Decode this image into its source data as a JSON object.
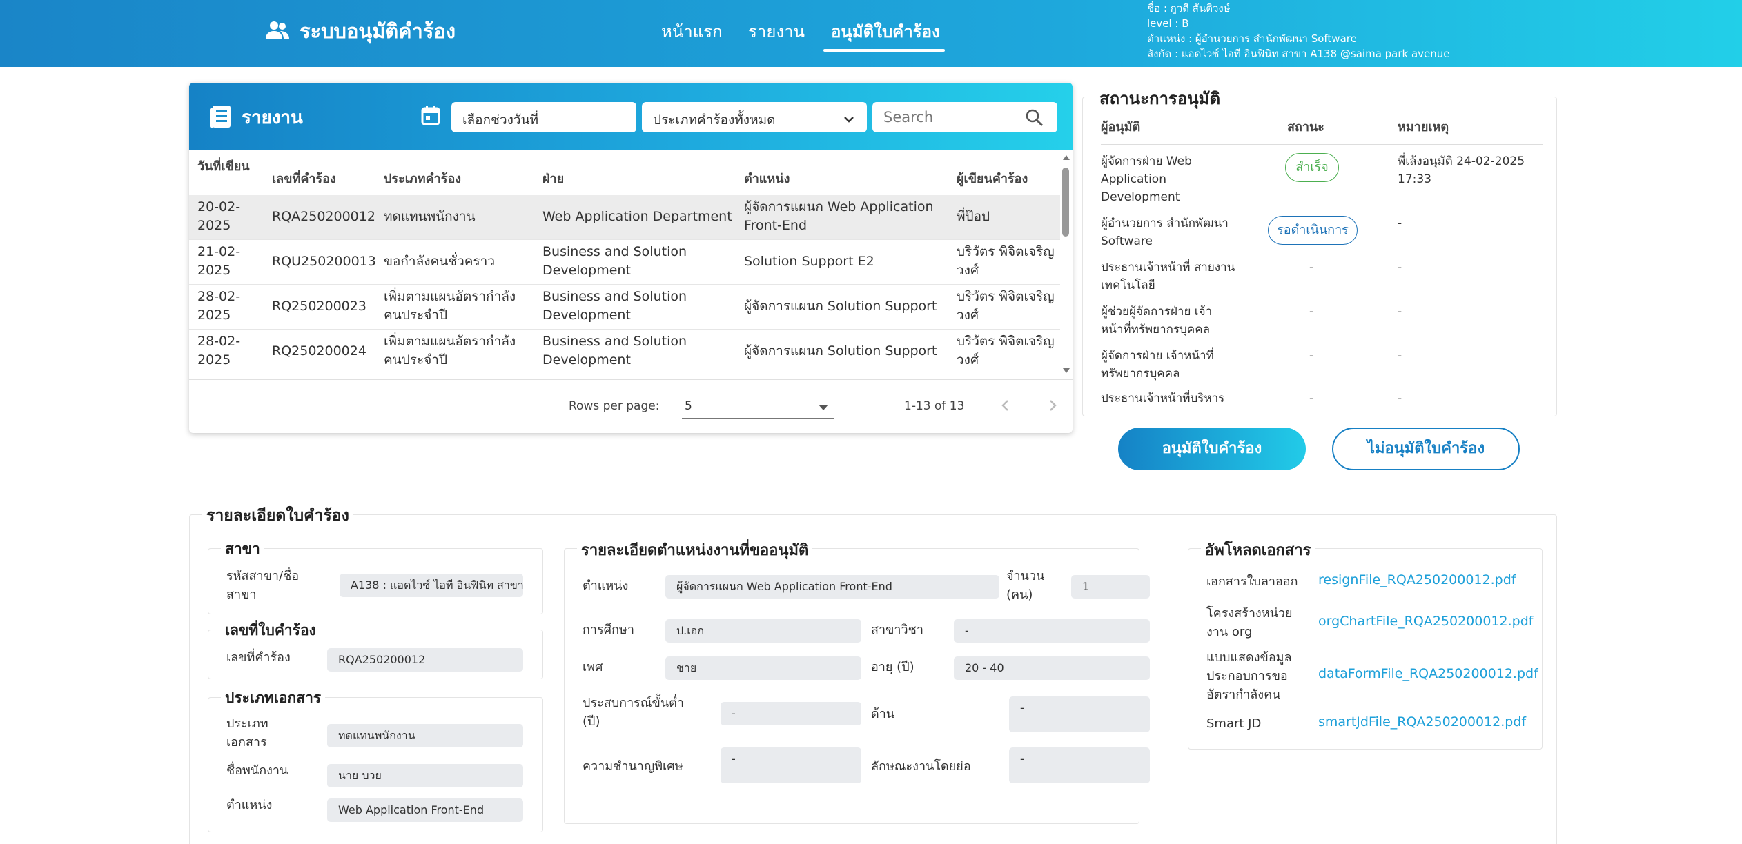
{
  "header": {
    "app_title": "ระบบอนุมัติคำร้อง",
    "nav": [
      {
        "label": "หน้าแรก"
      },
      {
        "label": "รายงาน"
      },
      {
        "label": "อนุมัติใบคำร้อง",
        "active": true
      }
    ],
    "user": {
      "name": "ชื่อ : กูวดี สันติวงษ์",
      "level": "level : B",
      "position": "ตำแหน่ง : ผู้อำนวยการ สำนักพัฒนา Software",
      "affiliation": "สังกัด : แอดไวซ์ ไอที อินฟินิท สาขา A138 @saima park avenue"
    }
  },
  "report": {
    "title": "รายงาน",
    "date_placeholder": "เลือกช่วงวันที่",
    "type_select": "ประเภทคำร้องทั้งหมด",
    "search_placeholder": "Search",
    "columns": [
      "วันที่เขียน",
      "เลขที่คำร้อง",
      "ประเภทคำร้อง",
      "ฝ่าย",
      "ตำแหน่ง",
      "ผู้เขียนคำร้อง"
    ],
    "rows": [
      {
        "date": "20-02-2025",
        "no": "RQA250200012",
        "type": "ทดแทนพนักงาน",
        "dept": "Web Application Department",
        "position": "ผู้จัดการแผนก Web Application Front-End",
        "writer": "พี่ป๊อป"
      },
      {
        "date": "21-02-2025",
        "no": "RQU250200013",
        "type": "ขอกำลังคนชั่วคราว",
        "dept": "Business and Solution Development",
        "position": "Solution Support E2",
        "writer": "บริวัตร พิจิตเจริญวงศ์"
      },
      {
        "date": "28-02-2025",
        "no": "RQ250200023",
        "type": "เพิ่มตามแผนอัตรากำลังคนประจำปี",
        "dept": "Business and Solution Development",
        "position": "ผู้จัดการแผนก Solution Support",
        "writer": "บริวัตร พิจิตเจริญวงศ์"
      },
      {
        "date": "28-02-2025",
        "no": "RQ250200024",
        "type": "เพิ่มตามแผนอัตรากำลังคนประจำปี",
        "dept": "Business and Solution Development",
        "position": "ผู้จัดการแผนก Solution Support",
        "writer": "บริวัตร พิจิตเจริญวงศ์"
      }
    ],
    "pagination": {
      "rows_per_page_label": "Rows per page:",
      "rows_per_page": "5",
      "range": "1-13 of 13"
    }
  },
  "approval": {
    "title": "สถานะการอนุมัติ",
    "columns": [
      "ผู้อนุมัติ",
      "สถานะ",
      "หมายเหตุ"
    ],
    "rows": [
      {
        "approver": "ผู้จัดการฝ่าย Web Application Development",
        "status": "สำเร็จ",
        "note": "พี่เล้งอนุมัติ 24-02-2025 17:33"
      },
      {
        "approver": "ผู้อำนวยการ สำนักพัฒนา Software",
        "status": "รอดำเนินการ",
        "note": "-"
      },
      {
        "approver": "ประธานเจ้าหน้าที่ สายงานเทคโนโลยี",
        "status": "-",
        "note": "-"
      },
      {
        "approver": "ผู้ช่วยผู้จัดการฝ่าย เจ้าหน้าที่ทรัพยากรบุคคล",
        "status": "-",
        "note": "-"
      },
      {
        "approver": "ผู้จัดการฝ่าย เจ้าหน้าที่ทรัพยากรบุคคล",
        "status": "-",
        "note": "-"
      },
      {
        "approver": "ประธานเจ้าหน้าที่บริหาร",
        "status": "-",
        "note": "-"
      }
    ],
    "approve_button": "อนุมัติใบคำร้อง",
    "reject_button": "ไม่อนุมัติใบคำร้อง"
  },
  "details": {
    "title": "รายละเอียดใบคำร้อง",
    "branch": {
      "title": "สาขา",
      "code_label": "รหัสสาขา/ชื่อสาขา",
      "code_value": "A138 : แอดไวซ์ ไอที อินฟินิท สาขา A"
    },
    "request": {
      "title": "เลขที่ใบคำร้อง",
      "no_label": "เลขที่คำร้อง",
      "no_value": "RQA250200012"
    },
    "doc_type": {
      "title": "ประเภทเอกสาร",
      "type_label": "ประเภทเอกสาร",
      "type_value": "ทดแทนพนักงาน",
      "emp_label": "ชื่อพนักงาน",
      "emp_value": "นาย บวย",
      "pos_label": "ตำแหน่ง",
      "pos_value": "Web Application Front-End"
    },
    "position": {
      "title": "รายละเอียดตำแหน่งงานที่ขออนุมัติ",
      "position_label": "ตำแหน่ง",
      "position_value": "ผู้จัดการแผนก Web Application Front-End",
      "count_label": "จำนวน (คน)",
      "count_value": "1",
      "education_label": "การศึกษา",
      "education_value": "ป.เอก",
      "major_label": "สาขาวิชา",
      "major_value": "-",
      "gender_label": "เพศ",
      "gender_value": "ชาย",
      "age_label": "อายุ (ปี)",
      "age_value": "20 - 40",
      "exp_label": "ประสบการณ์ขั้นต่ำ (ปี)",
      "exp_value": "-",
      "field_label": "ด้าน",
      "field_value": "-",
      "skill_label": "ความชำนาญพิเศษ",
      "skill_value": "-",
      "nature_label": "ลักษณะงานโดยย่อ",
      "nature_value": "-"
    },
    "uploads": {
      "title": "อัพโหลดเอกสาร",
      "items": [
        {
          "label": "เอกสารใบลาออก",
          "file": "resignFile_RQA250200012.pdf"
        },
        {
          "label": "โครงสร้างหน่วยงาน org",
          "file": "orgChartFile_RQA250200012.pdf"
        },
        {
          "label": "แบบแสดงข้อมูลประกอบการขออัตรากำลังคน",
          "file": "dataFormFile_RQA250200012.pdf"
        },
        {
          "label": "Smart JD",
          "file": "smartJdFile_RQA250200012.pdf"
        }
      ]
    }
  },
  "colors": {
    "brand_start": "#1582c6",
    "brand_end": "#22cfe8",
    "success": "#4caf50",
    "pending": "#1e73b8",
    "link": "#1ea0d9"
  }
}
